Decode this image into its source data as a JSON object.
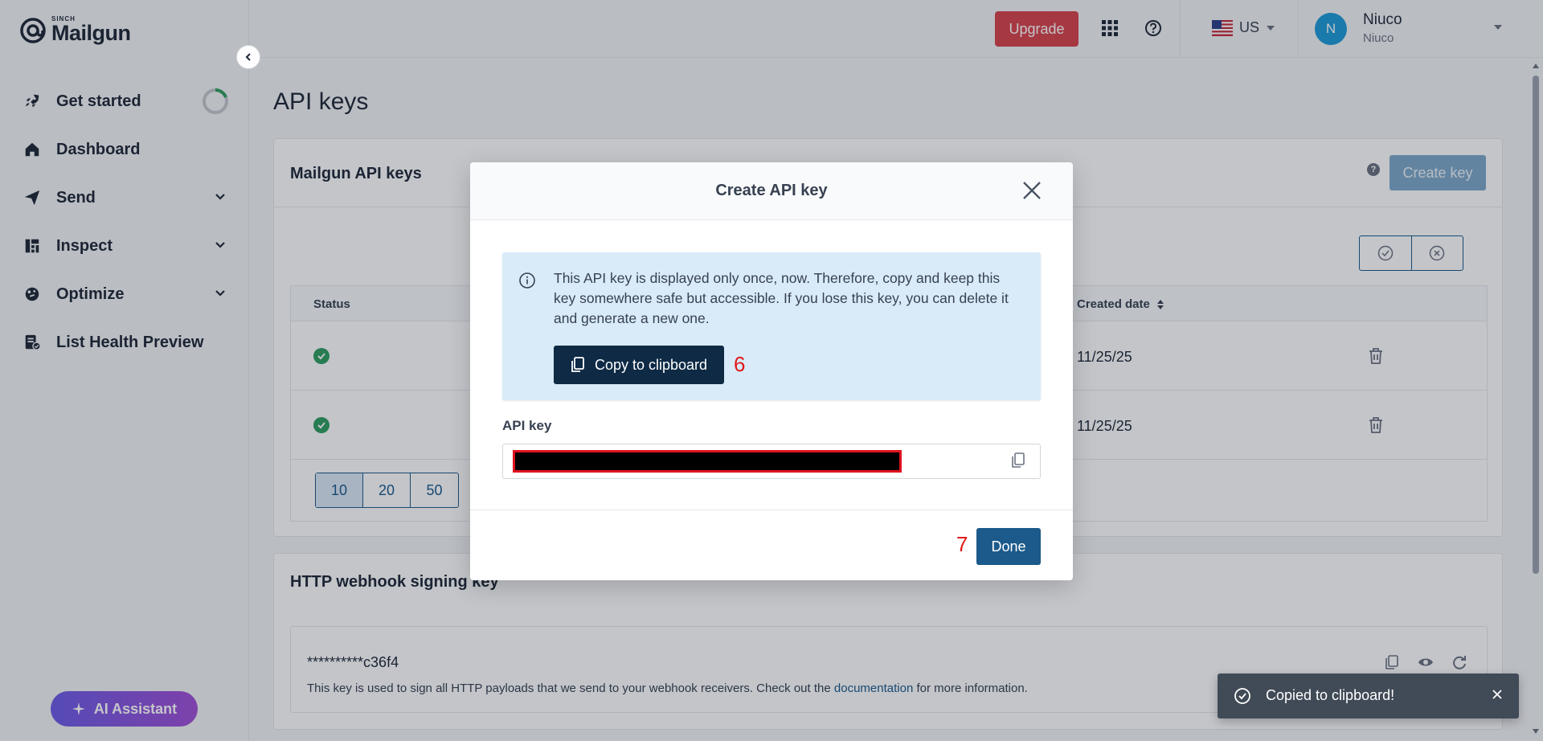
{
  "brand": {
    "sup": "SINCH",
    "name": "Mailgun"
  },
  "sidebar": {
    "items": [
      {
        "label": "Get started",
        "icon": "rocket-icon"
      },
      {
        "label": "Dashboard",
        "icon": "home-icon"
      },
      {
        "label": "Send",
        "icon": "send-icon"
      },
      {
        "label": "Inspect",
        "icon": "inspect-icon"
      },
      {
        "label": "Optimize",
        "icon": "optimize-icon"
      },
      {
        "label": "List Health Preview",
        "icon": "list-health-icon"
      }
    ],
    "ai_assistant": "AI Assistant"
  },
  "topbar": {
    "upgrade": "Upgrade",
    "region": "US",
    "avatar_initial": "N",
    "user_name": "Niuco",
    "user_org": "Niuco"
  },
  "page": {
    "title": "API keys"
  },
  "api_keys_card": {
    "title": "Mailgun API keys",
    "create_key": "Create key",
    "columns": {
      "status": "Status",
      "created": "Created date"
    },
    "rows": [
      {
        "status": "active",
        "created": "11/25/25"
      },
      {
        "status": "active",
        "created": "11/25/25"
      }
    ],
    "page_sizes": [
      "10",
      "20",
      "50"
    ],
    "active_page_size": "10"
  },
  "webhook_card": {
    "title": "HTTP webhook signing key",
    "masked_key": "**********c36f4",
    "desc_before": "This key is used to sign all HTTP payloads that we send to your webhook receivers. Check out the ",
    "desc_link": "documentation",
    "desc_after": " for more information."
  },
  "modal": {
    "title": "Create API key",
    "info": "This API key is displayed only once, now. Therefore, copy and keep this key somewhere safe but accessible. If you lose this key, you can delete it and generate a new one.",
    "copy_button": "Copy to clipboard",
    "field_label": "API key",
    "done": "Done",
    "step_copy": "6",
    "step_done": "7"
  },
  "toast": {
    "text": "Copied to clipboard!"
  },
  "colors": {
    "upgrade": "#d8434b",
    "primary": "#1b5a8a",
    "dark_button": "#0e2a45",
    "info_bg": "#d9ebf9",
    "success": "#2f9e5f",
    "step_marker": "#e01a1a"
  }
}
